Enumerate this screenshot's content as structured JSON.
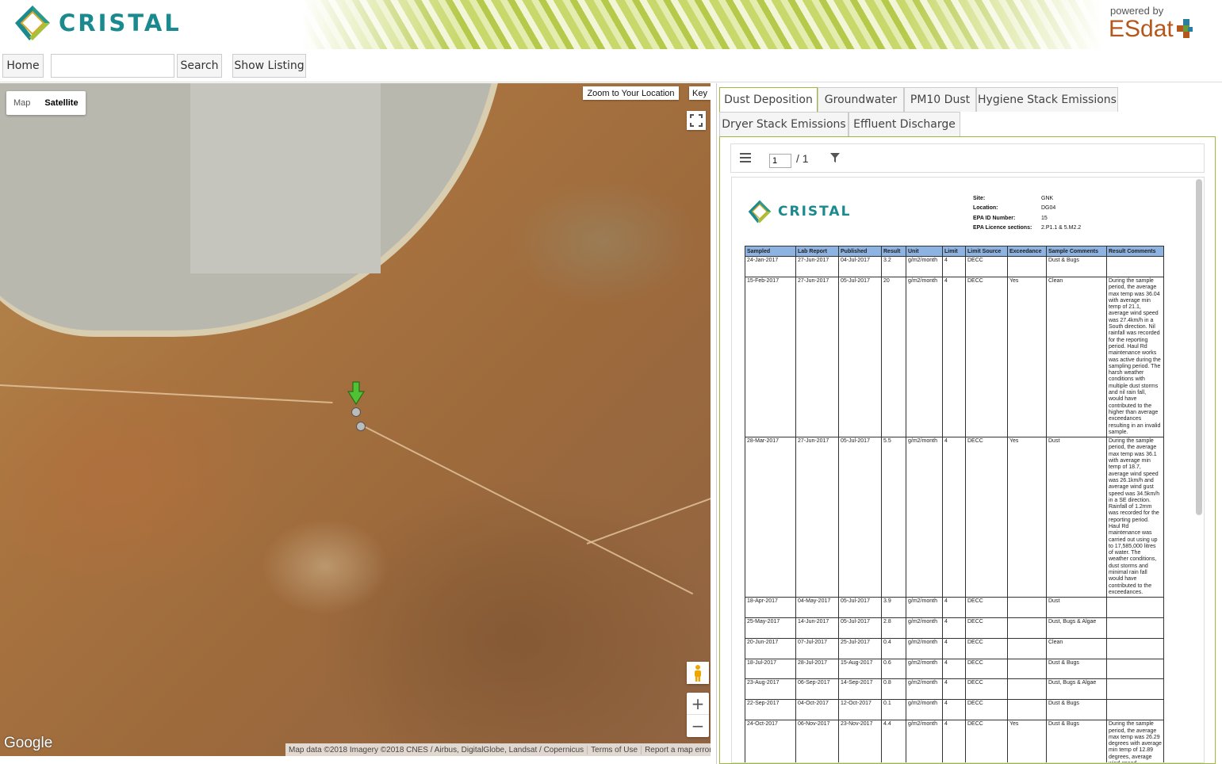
{
  "header": {
    "brand": "CRISTAL",
    "powered_by": "powered by",
    "esdat": "ESdat"
  },
  "toolbar": {
    "home": "Home",
    "search_value": "",
    "search": "Search",
    "show_listing": "Show Listing"
  },
  "map": {
    "type_map": "Map",
    "type_satellite": "Satellite",
    "zoom_to_location": "Zoom to Your Location",
    "key": "Key",
    "zoom_in": "+",
    "zoom_out": "−",
    "google": "Google",
    "attribution": "Map data ©2018 Imagery ©2018 CNES / Airbus, DigitalGlobe, Landsat / Copernicus",
    "terms": "Terms of Use",
    "report": "Report a map error"
  },
  "tabs": [
    {
      "label": "Dust Deposition",
      "active": true
    },
    {
      "label": "Groundwater"
    },
    {
      "label": "PM10 Dust"
    },
    {
      "label": "Hygiene Stack Emissions"
    },
    {
      "label": "Dryer Stack Emissions"
    },
    {
      "label": "Effluent Discharge"
    }
  ],
  "pdf": {
    "page_value": "1",
    "page_total": "/ 1",
    "brand": "CRISTAL",
    "site_info": [
      {
        "k": "Site:",
        "v": "GNK"
      },
      {
        "k": "Location:",
        "v": "DG04"
      },
      {
        "k": "EPA ID Number:",
        "v": "15"
      },
      {
        "k": "EPA Licence sections:",
        "v": "2.P1.1 & 5.M2.2"
      }
    ],
    "columns": [
      "Sampled",
      "Lab Report",
      "Published",
      "Result",
      "Unit",
      "Limit",
      "Limit Source",
      "Exceedance",
      "Sample Comments",
      "Result Comments"
    ],
    "rows": [
      [
        "24-Jan-2017",
        "27-Jun-2017",
        "04-Jul-2017",
        "3.2",
        "g/m2/month",
        "4",
        "DECC",
        "",
        "Dust & Bugs",
        ""
      ],
      [
        "15-Feb-2017",
        "27-Jun-2017",
        "05-Jul-2017",
        "20",
        "g/m2/month",
        "4",
        "DECC",
        "Yes",
        "Clean",
        "During the sample period, the average max temp was 36.04 with average min temp of 21.1, average wind speed was 27.4km/h in a South direction. Nil rainfall was recorded for the reporting period. Haul Rd maintenance works was active during the sampling period. The harsh weather conditions with multiple dust storms and nil rain fall, would have contributed to the higher than average exceedances resulting in an invalid sample."
      ],
      [
        "28-Mar-2017",
        "27-Jun-2017",
        "05-Jul-2017",
        "5.5",
        "g/m2/month",
        "4",
        "DECC",
        "Yes",
        "Dust",
        "During the sample period, the average max temp was 36.1 with average min temp of 18.7, average wind speed was 26.1km/h and average wind gust speed was 34.5km/h in a SE direction. Rainfall of 1.2mm was recorded for the reporting period. Haul Rd maintenance was carried out using up to 17,585,000 litres of water. The weather conditions, dust storms and minimal rain fall would have contributed to the exceedances."
      ],
      [
        "18-Apr-2017",
        "04-May-2017",
        "05-Jul-2017",
        "3.9",
        "g/m2/month",
        "4",
        "DECC",
        "",
        "Dust",
        ""
      ],
      [
        "25-May-2017",
        "14-Jun-2017",
        "05-Jul-2017",
        "2.8",
        "g/m2/month",
        "4",
        "DECC",
        "",
        "Dust, Bugs & Algae",
        ""
      ],
      [
        "20-Jun-2017",
        "07-Jul-2017",
        "25-Jul-2017",
        "0.4",
        "g/m2/month",
        "4",
        "DECC",
        "",
        "Clean",
        ""
      ],
      [
        "18-Jul-2017",
        "28-Jul-2017",
        "15-Aug-2017",
        "0.6",
        "g/m2/month",
        "4",
        "DECC",
        "",
        "Dust & Bugs",
        ""
      ],
      [
        "23-Aug-2017",
        "06-Sep-2017",
        "14-Sep-2017",
        "0.8",
        "g/m2/month",
        "4",
        "DECC",
        "",
        "Dust, Bugs & Algae",
        ""
      ],
      [
        "22-Sep-2017",
        "04-Oct-2017",
        "12-Oct-2017",
        "0.1",
        "g/m2/month",
        "4",
        "DECC",
        "",
        "Dust & Bugs",
        ""
      ],
      [
        "24-Oct-2017",
        "06-Nov-2017",
        "23-Nov-2017",
        "4.4",
        "g/m2/month",
        "4",
        "DECC",
        "Yes",
        "Dust & Bugs",
        "During the sample period, the average max temp was 26.29 degrees with average min temp of 12.89 degrees, average wind speed"
      ]
    ]
  }
}
